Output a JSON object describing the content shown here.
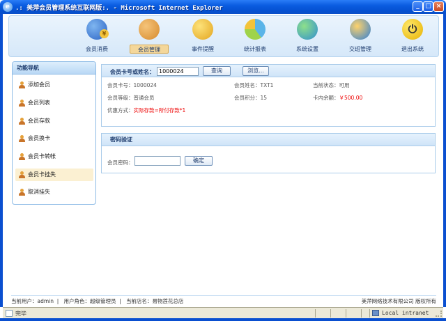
{
  "window": {
    "title": ".: 美萍会员管理系统互联网版:. - Microsoft Internet Explorer",
    "minimize": "_",
    "maximize": "□",
    "close": "×"
  },
  "nav": [
    {
      "label": "会员消费",
      "icon": "coin-user-icon"
    },
    {
      "label": "会员管理",
      "icon": "users-icon"
    },
    {
      "label": "事件提醒",
      "icon": "chat-bubble-icon"
    },
    {
      "label": "统计报表",
      "icon": "pie-chart-icon"
    },
    {
      "label": "系统设置",
      "icon": "settings-globe-icon"
    },
    {
      "label": "交班管理",
      "icon": "shift-arrow-icon"
    },
    {
      "label": "退出系统",
      "icon": "power-icon"
    }
  ],
  "sidebar": {
    "title": "功能导航",
    "items": [
      "添加会员",
      "会员列表",
      "会员存款",
      "会员换卡",
      "会员卡转帐",
      "会员卡挂失",
      "取消挂失"
    ],
    "active_index": 5
  },
  "search": {
    "label": "会员卡号或姓名：",
    "value": "1000024",
    "query_button": "查询",
    "browse_button": "浏览..."
  },
  "member": {
    "card_label": "会员卡号：",
    "card_value": "1000024",
    "name_label": "会员姓名：",
    "name_value": "TXT1",
    "status_label": "当前状态：",
    "status_value": "可用",
    "level_label": "会员等级：",
    "level_value": "普通会员",
    "points_label": "会员积分：",
    "points_value": "15",
    "balance_label": "卡内余额：",
    "balance_value": "￥500.00",
    "discount_label": "优惠方式：",
    "discount_value": "实际存款=所付存款*1"
  },
  "password": {
    "title": "密码验证",
    "label": "会员密码：",
    "confirm_button": "确定"
  },
  "footer": {
    "user": "当前用户：admin",
    "role": "用户角色：超级管理员",
    "store": "当前店名：易物莲花总店",
    "copyright": "美萍网络技术有限公司 版权所有"
  },
  "statusbar": {
    "text": "完毕",
    "zone": "Local intranet"
  }
}
